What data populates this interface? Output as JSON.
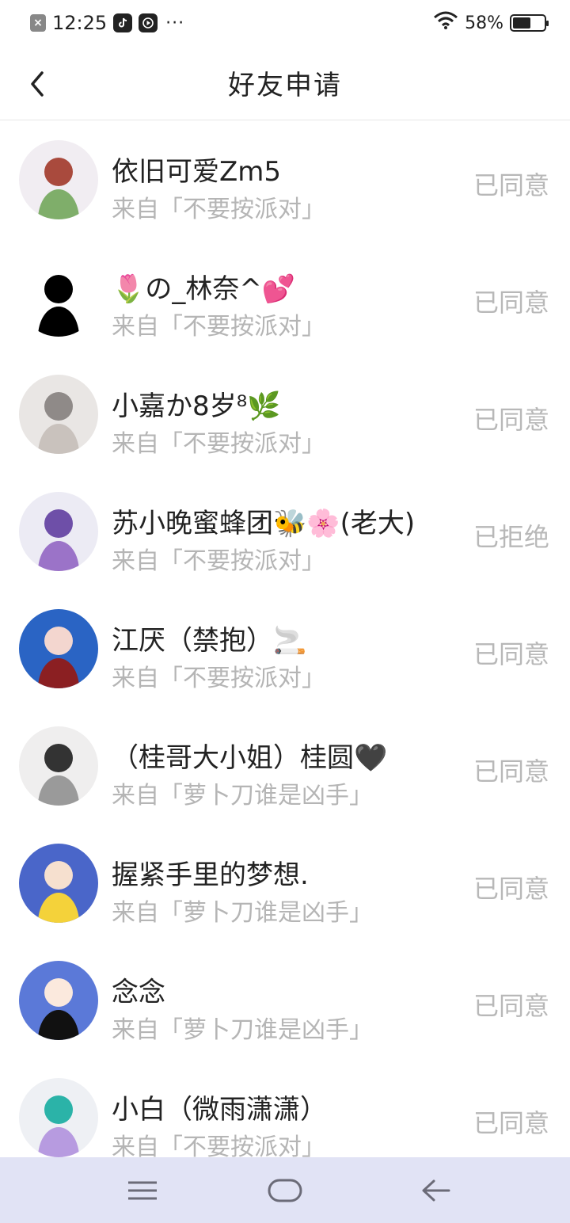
{
  "status_bar": {
    "time": "12:25",
    "dots": "···",
    "battery_percent": "58%",
    "battery_level": 0.58
  },
  "header": {
    "title": "好友申请"
  },
  "requests": [
    {
      "name": "依旧可爱Zm5",
      "source": "来自「不要按派对」",
      "status": "已同意",
      "avatar_colors": [
        "#f1edf2",
        "#7fae6a",
        "#a94a3d"
      ]
    },
    {
      "name": "🌷の_林奈^💕",
      "source": "来自「不要按派对」",
      "status": "已同意",
      "avatar_colors": [
        "#ffffff",
        "#000000",
        "#000000"
      ]
    },
    {
      "name": "小嘉か8岁⁸🌿",
      "source": "来自「不要按派对」",
      "status": "已同意",
      "avatar_colors": [
        "#e9e6e4",
        "#c9c2bd",
        "#8f8a88"
      ]
    },
    {
      "name": "苏小晚蜜蜂团🐝🌸(老大)",
      "source": "来自「不要按派对」",
      "status": "已拒绝",
      "avatar_colors": [
        "#ecebf4",
        "#9b73c8",
        "#6e4fa8"
      ]
    },
    {
      "name": "江厌（禁抱）🚬",
      "source": "来自「不要按派对」",
      "status": "已同意",
      "avatar_colors": [
        "#2a64c4",
        "#8b1f22",
        "#f3d6cf"
      ]
    },
    {
      "name": "（桂哥大小姐）桂圆🖤",
      "source": "来自「萝卜刀谁是凶手」",
      "status": "已同意",
      "avatar_colors": [
        "#efeeee",
        "#9a9a9a",
        "#333333"
      ]
    },
    {
      "name": "握紧手里的梦想.",
      "source": "来自「萝卜刀谁是凶手」",
      "status": "已同意",
      "avatar_colors": [
        "#4a66c9",
        "#f4d23a",
        "#f6e0cf"
      ]
    },
    {
      "name": "念念",
      "source": "来自「萝卜刀谁是凶手」",
      "status": "已同意",
      "avatar_colors": [
        "#5b79d8",
        "#111111",
        "#fbe9dd"
      ]
    },
    {
      "name": "小白（微雨潇潇）",
      "source": "来自「不要按派对」",
      "status": "已同意",
      "avatar_colors": [
        "#eef0f4",
        "#b79be0",
        "#2bb3a8"
      ]
    }
  ],
  "colors": {
    "text_primary": "#222222",
    "text_secondary": "#b5b5b5",
    "navbar_bg": "#e1e3f5",
    "nav_icon": "#6b6b78"
  },
  "nav": {
    "icons": [
      "menu-icon",
      "home-icon",
      "back-arrow-icon"
    ]
  }
}
